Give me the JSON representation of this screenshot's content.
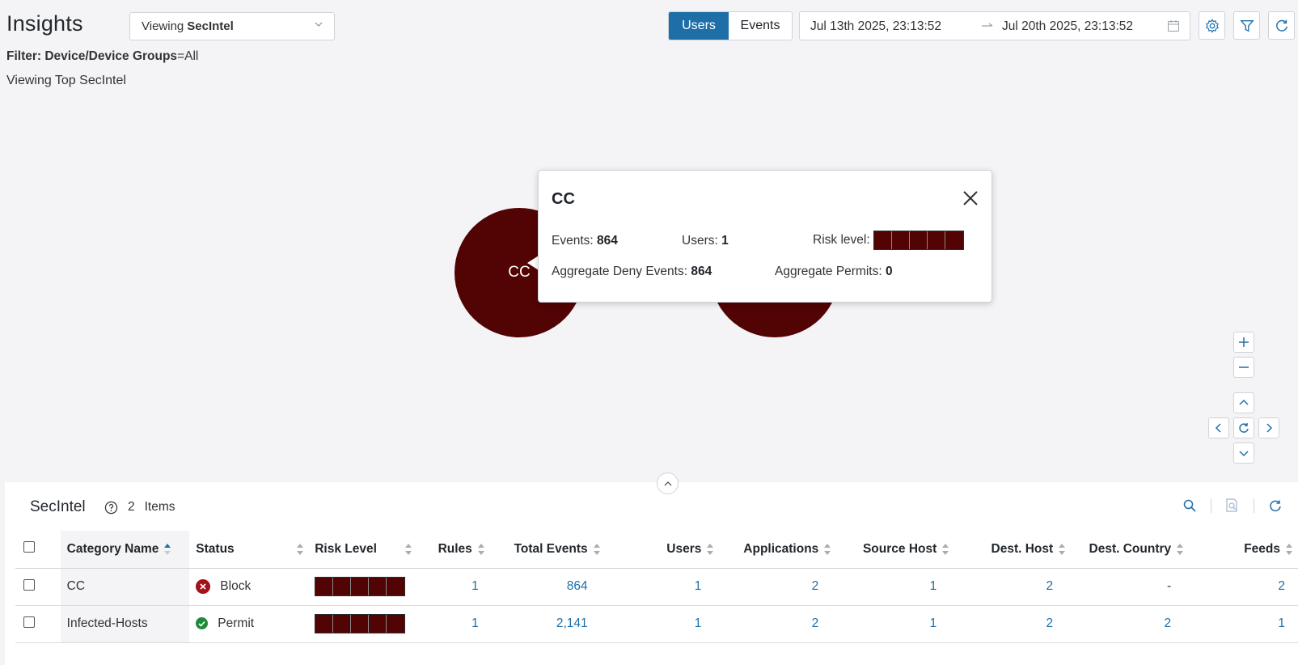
{
  "header": {
    "title": "Insights",
    "view_prefix": "Viewing",
    "view_value": "SecIntel",
    "filter_label": "Filter: Device/Device Groups",
    "filter_value": "=All",
    "viewing_top": "Viewing Top SecIntel"
  },
  "toggle": {
    "users": "Users",
    "events": "Events",
    "active": "Users"
  },
  "date_range": {
    "start": "Jul 13th 2025, 23:13:52",
    "end": "Jul 20th 2025, 23:13:52",
    "arrow": "→"
  },
  "bubbles": [
    {
      "label": "CC"
    },
    {
      "label": ""
    }
  ],
  "popup": {
    "title": "CC",
    "events_label": "Events:",
    "events_value": "864",
    "users_label": "Users:",
    "users_value": "1",
    "risk_label": "Risk level:",
    "risk_segments": 5,
    "deny_label": "Aggregate Deny Events:",
    "deny_value": "864",
    "permits_label": "Aggregate Permits:",
    "permits_value": "0"
  },
  "panel": {
    "title": "SecIntel",
    "count": "2",
    "items_label": "Items"
  },
  "table": {
    "columns": [
      "Category Name",
      "Status",
      "Risk Level",
      "Rules",
      "Total Events",
      "Users",
      "Applications",
      "Source Host",
      "Dest. Host",
      "Dest. Country",
      "Feeds"
    ],
    "rows": [
      {
        "category": "CC",
        "status": "Block",
        "status_kind": "block",
        "risk": 5,
        "rules": "1",
        "total_events": "864",
        "users": "1",
        "applications": "2",
        "source_host": "1",
        "dest_host": "2",
        "dest_country": "-",
        "feeds": "2"
      },
      {
        "category": "Infected-Hosts",
        "status": "Permit",
        "status_kind": "permit",
        "risk": 5,
        "rules": "1",
        "total_events": "2,141",
        "users": "1",
        "applications": "2",
        "source_host": "1",
        "dest_host": "2",
        "dest_country": "2",
        "feeds": "1"
      }
    ]
  },
  "colors": {
    "accent": "#1e6fa8",
    "risk": "#520303",
    "block": "#a3121b",
    "permit": "#1f8a3a"
  }
}
